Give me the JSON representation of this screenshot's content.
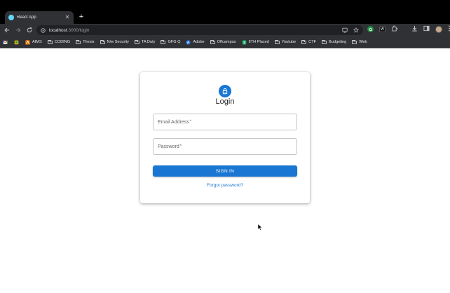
{
  "browser": {
    "tab": {
      "title": "React App",
      "close": "✕"
    },
    "new_tab": "+",
    "url_host": "localhost",
    "url_path": ":3000/login",
    "extension_label": "W"
  },
  "bookmarks": [
    {
      "label": "",
      "kind": "gmail"
    },
    {
      "label": "",
      "kind": "drive"
    },
    {
      "label": "AIMS",
      "kind": "site"
    },
    {
      "label": "CODING",
      "kind": "folder"
    },
    {
      "label": "Thesis",
      "kind": "folder"
    },
    {
      "label": "N/w Security",
      "kind": "folder"
    },
    {
      "label": "TA Duty",
      "kind": "folder"
    },
    {
      "label": "GFG Q",
      "kind": "folder"
    },
    {
      "label": "Adobe",
      "kind": "site"
    },
    {
      "label": "Offcampus",
      "kind": "folder"
    },
    {
      "label": "IITH Placed",
      "kind": "sheet"
    },
    {
      "label": "Youtube",
      "kind": "folder"
    },
    {
      "label": "CTF",
      "kind": "folder"
    },
    {
      "label": "Budgeting",
      "kind": "folder"
    },
    {
      "label": "Web",
      "kind": "folder"
    }
  ],
  "login": {
    "title": "Login",
    "email_label": "Email Address",
    "password_label": "Password",
    "required_mark": "*",
    "signin_label": "SIGN IN",
    "forgot_label": "Forgot password?"
  },
  "colors": {
    "primary": "#1976d2",
    "chrome_dark": "#303134"
  }
}
